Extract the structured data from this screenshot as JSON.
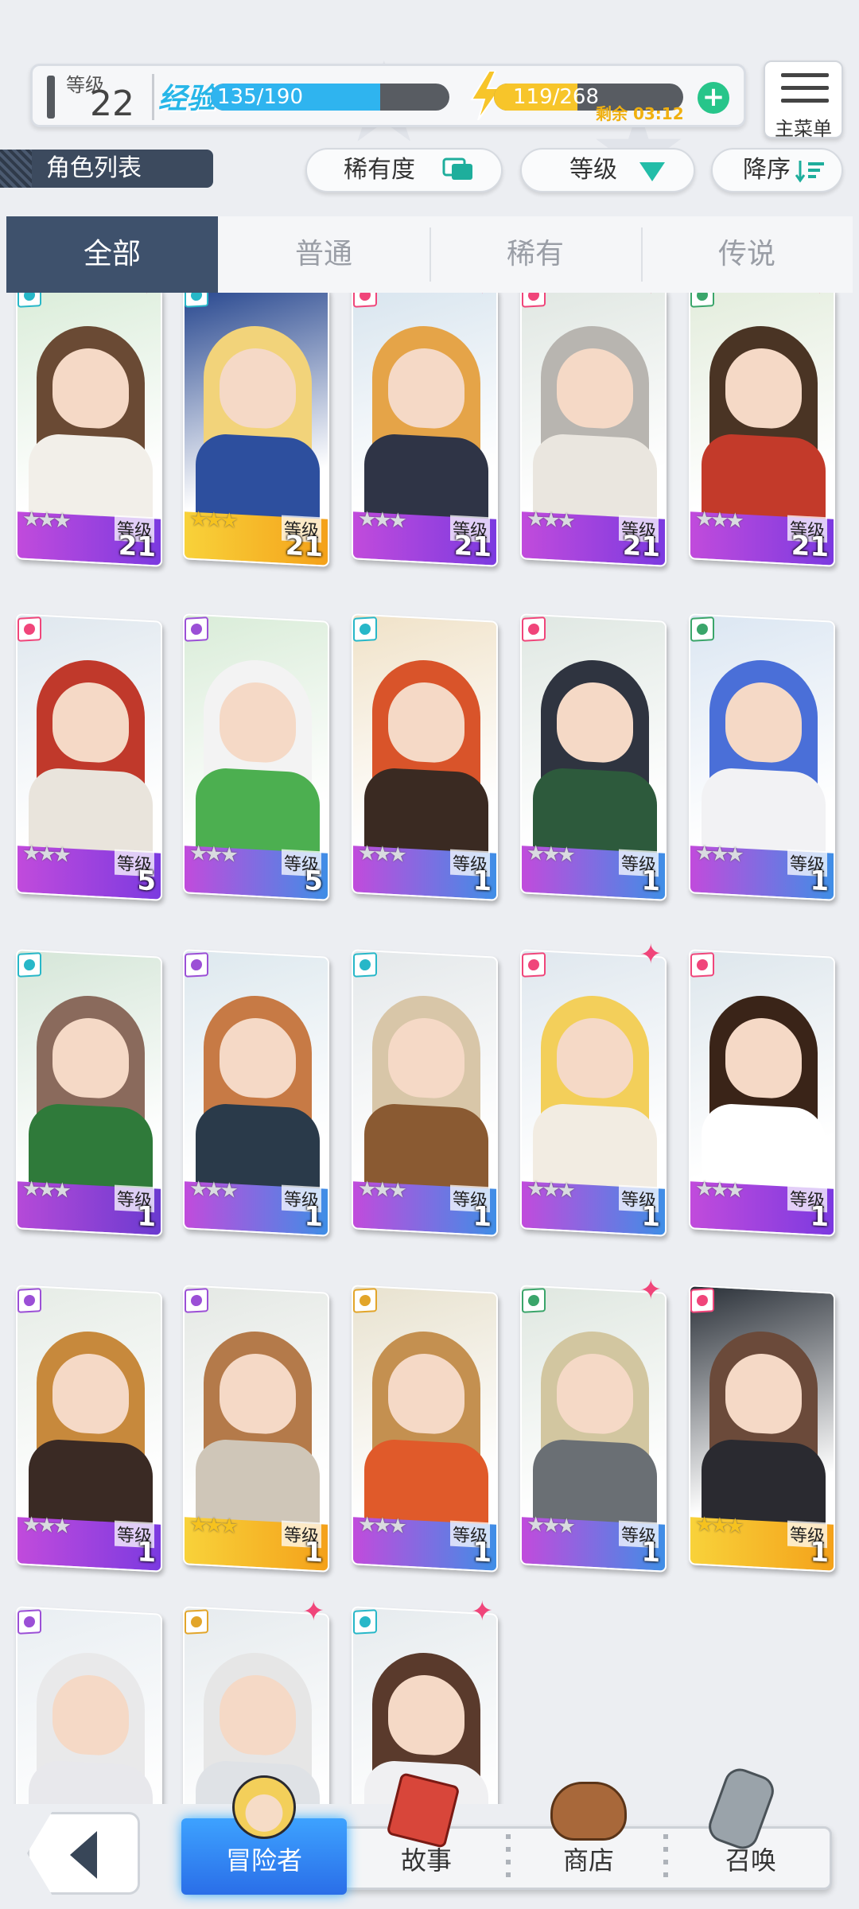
{
  "status": {
    "level_label": "等级",
    "level_value": "22",
    "exp_label": "经验",
    "exp_text": "135/190",
    "exp_fraction": 0.71,
    "energy_text": "119/268",
    "energy_fraction": 0.44,
    "energy_timer": "剩余 03:12"
  },
  "menu": {
    "label": "主菜单"
  },
  "page_title": "角色列表",
  "sort": {
    "rarity_label": "稀有度",
    "level_label": "等级",
    "order_label": "降序"
  },
  "tabs": [
    "全部",
    "普通",
    "稀有",
    "传说"
  ],
  "card_level_label": "等级",
  "cards": [
    {
      "level": "21",
      "stars": 3,
      "gold": false,
      "element": "teal",
      "pink_star": true,
      "hair": "#6a4a34",
      "outfit": "#f2efe9",
      "bg": "#d9ecd8"
    },
    {
      "level": "21",
      "stars": 3,
      "gold": true,
      "element": "teal",
      "pink_star": false,
      "hair": "#f2d37a",
      "outfit": "#2d4f9e",
      "bg": "#1e3f8a"
    },
    {
      "level": "21",
      "stars": 3,
      "gold": false,
      "element": "pink",
      "pink_star": true,
      "hair": "#e5a448",
      "outfit": "#2f3446",
      "bg": "#d7e4ee"
    },
    {
      "level": "21",
      "stars": 3,
      "gold": false,
      "element": "pink",
      "pink_star": true,
      "hair": "#b8b5b0",
      "outfit": "#eae6df",
      "bg": "#dfe6e1"
    },
    {
      "level": "21",
      "stars": 3,
      "gold": false,
      "element": "green",
      "pink_star": true,
      "hair": "#4a3424",
      "outfit": "#c33a2a",
      "bg": "#e2ecdb"
    },
    {
      "level": "5",
      "stars": 3,
      "gold": false,
      "element": "pink",
      "pink_star": false,
      "hair": "#c0392b",
      "outfit": "#e9e4dc",
      "bg": "#dfe7ee"
    },
    {
      "level": "5",
      "stars": 3,
      "gold": false,
      "element": "purple",
      "pink_star": false,
      "hair": "#f3f3f3",
      "outfit": "#4caf50",
      "bg": "#d9ecd8"
    },
    {
      "level": "1",
      "stars": 3,
      "gold": false,
      "element": "teal",
      "pink_star": false,
      "hair": "#d9542a",
      "outfit": "#3a2a22",
      "bg": "#f0e2c8"
    },
    {
      "level": "1",
      "stars": 3,
      "gold": false,
      "element": "pink",
      "pink_star": false,
      "hair": "#2f3440",
      "outfit": "#2d5a3c",
      "bg": "#dfe7e2"
    },
    {
      "level": "1",
      "stars": 3,
      "gold": false,
      "element": "green",
      "pink_star": false,
      "hair": "#4a6fd8",
      "outfit": "#f2f2f4",
      "bg": "#dbe6f2"
    },
    {
      "level": "1",
      "stars": 3,
      "gold": false,
      "element": "teal",
      "pink_star": false,
      "hair": "#8a6a5c",
      "outfit": "#2f7a3a",
      "bg": "#d5e6d8"
    },
    {
      "level": "1",
      "stars": 3,
      "gold": false,
      "element": "purple",
      "pink_star": false,
      "hair": "#c77a45",
      "outfit": "#2a3a4a",
      "bg": "#dde8ee"
    },
    {
      "level": "1",
      "stars": 3,
      "gold": false,
      "element": "teal",
      "pink_star": false,
      "hair": "#d8c6a8",
      "outfit": "#8a5a32",
      "bg": "#e4e8ea"
    },
    {
      "level": "1",
      "stars": 3,
      "gold": false,
      "element": "pink",
      "pink_star": true,
      "hair": "#f3cf5a",
      "outfit": "#f2ece2",
      "bg": "#dfe7ee"
    },
    {
      "level": "1",
      "stars": 3,
      "gold": false,
      "element": "pink",
      "pink_star": false,
      "hair": "#3a2418",
      "outfit": "#ffffff",
      "bg": "#dde6ec"
    },
    {
      "level": "1",
      "stars": 3,
      "gold": false,
      "element": "purple",
      "pink_star": false,
      "hair": "#c7893c",
      "outfit": "#3a2a24",
      "bg": "#e6ece6"
    },
    {
      "level": "1",
      "stars": 3,
      "gold": true,
      "element": "purple",
      "pink_star": false,
      "hair": "#b47a4a",
      "outfit": "#cfc6b8",
      "bg": "#e4e8e4"
    },
    {
      "level": "1",
      "stars": 3,
      "gold": false,
      "element": "gold",
      "pink_star": false,
      "hair": "#c49050",
      "outfit": "#e05a2a",
      "bg": "#e8e2cf"
    },
    {
      "level": "1",
      "stars": 3,
      "gold": false,
      "element": "green",
      "pink_star": true,
      "hair": "#d2c6a0",
      "outfit": "#6a6f74",
      "bg": "#dfe7e0"
    },
    {
      "level": "1",
      "stars": 3,
      "gold": true,
      "element": "pink",
      "pink_star": false,
      "hair": "#6b4a3a",
      "outfit": "#2a2a30",
      "bg": "#2a3038"
    },
    {
      "level": "",
      "stars": 0,
      "gold": false,
      "element": "purple",
      "pink_star": false,
      "hair": "#e9e9ea",
      "outfit": "#e8e8ec",
      "bg": "#e9eef2"
    },
    {
      "level": "",
      "stars": 0,
      "gold": false,
      "element": "gold",
      "pink_star": true,
      "hair": "#e6e6e6",
      "outfit": "#dfe2e6",
      "bg": "#e6ebee"
    },
    {
      "level": "",
      "stars": 0,
      "gold": false,
      "element": "teal",
      "pink_star": true,
      "hair": "#5a3a2c",
      "outfit": "#f0f0f2",
      "bg": "#e6ebee"
    }
  ],
  "nav": {
    "adventurer": "冒险者",
    "story": "故事",
    "shop": "商店",
    "summon": "召唤"
  },
  "colors": {
    "accent": "#3e516c",
    "exp": "#2fb4ef",
    "energy": "#f7c52a",
    "nav_active": "#2a6ee8"
  }
}
